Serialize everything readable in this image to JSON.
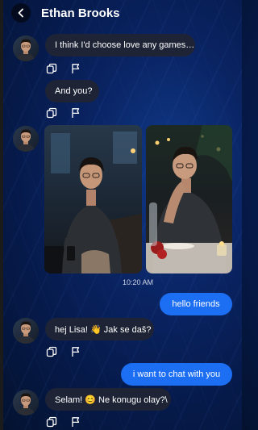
{
  "header": {
    "title": "Ethan Brooks"
  },
  "icons": {
    "back": "chevron-left-icon",
    "copy": "copy-icon",
    "report": "flag-icon",
    "avatar": "contact-avatar"
  },
  "colors": {
    "outgoing_bubble": "#1c6ef2",
    "incoming_bubble": "#1e2436",
    "background": "#0a2463"
  },
  "messages": [
    {
      "from": "contact",
      "text": "I think I'd choose love any games…"
    },
    {
      "from": "contact",
      "text": "And you?"
    },
    {
      "from": "contact",
      "type": "photos"
    },
    {
      "from": "me",
      "text": "hello friends"
    },
    {
      "from": "contact",
      "text": "hej Lisa! 👋 Jak se daš?"
    },
    {
      "from": "me",
      "text": "i want to chat with you"
    },
    {
      "from": "contact",
      "text": "Selam! 😊 Ne konugu olay?\\"
    }
  ],
  "timestamp": "10:20 AM"
}
